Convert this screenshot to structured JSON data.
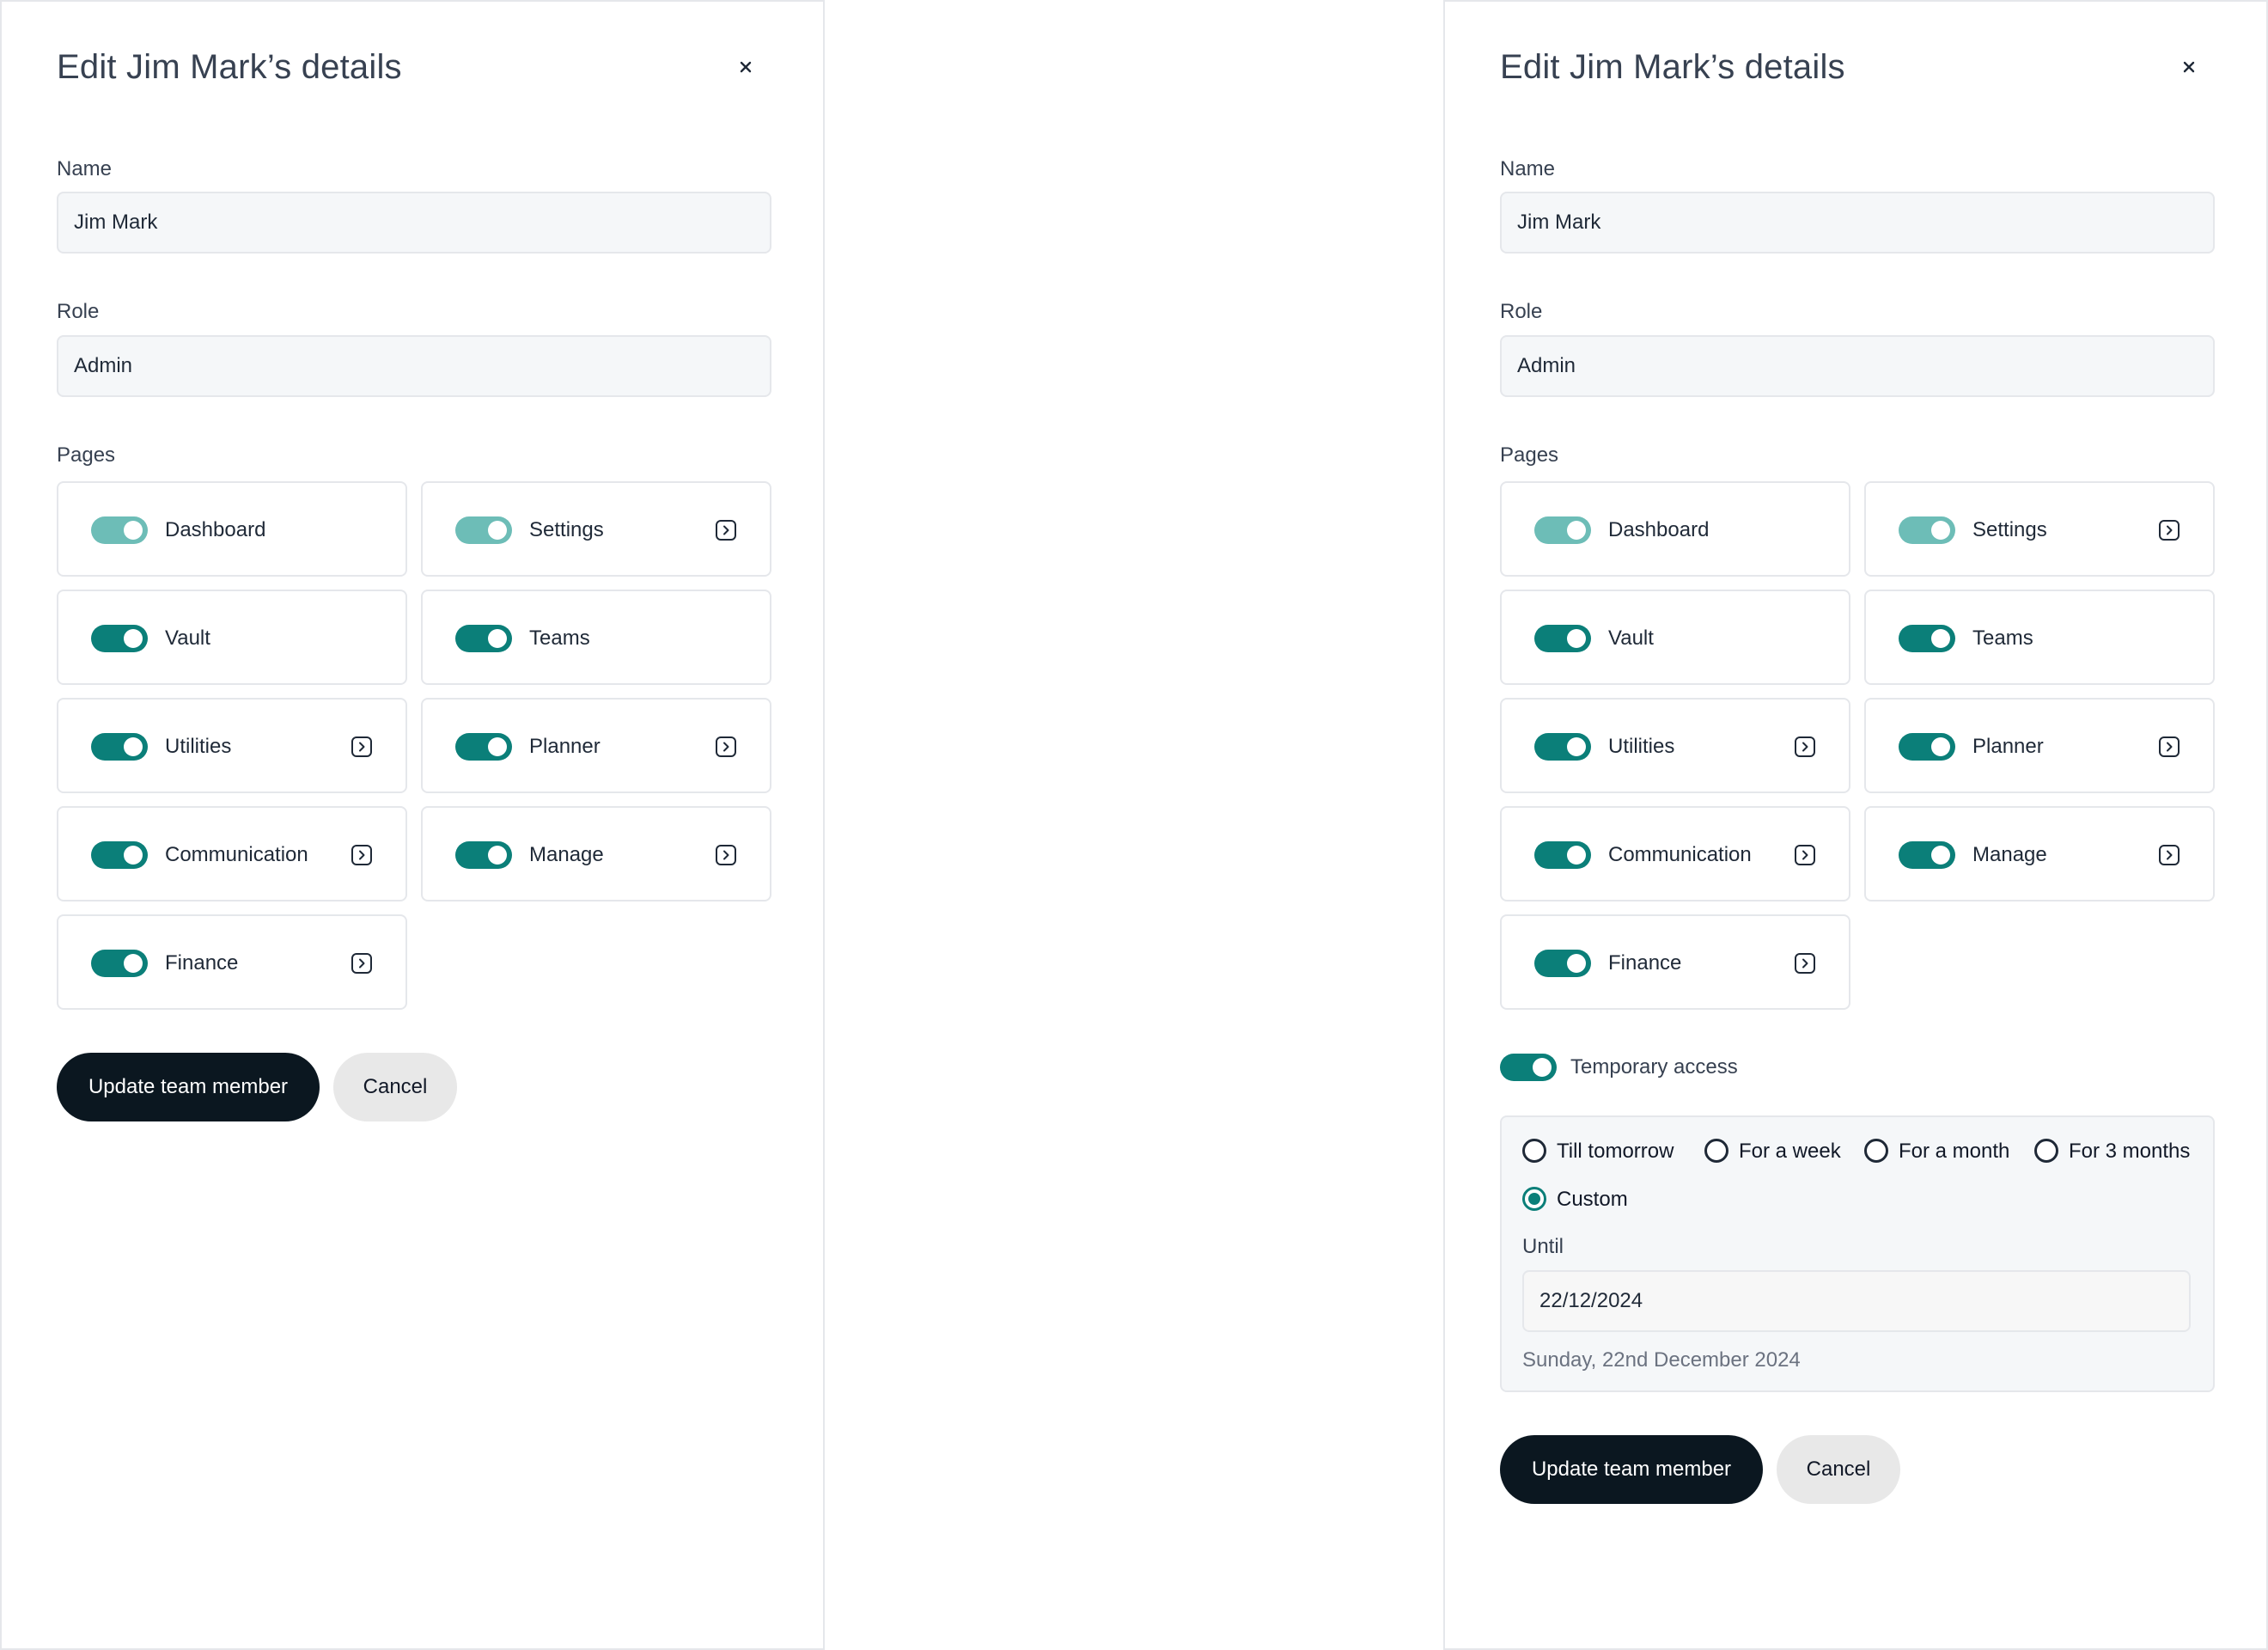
{
  "colors": {
    "accent": "#0b7f79",
    "accent_light": "#6dbdb7",
    "primary_button": "#0b1720",
    "secondary_button": "#e8e8e8",
    "input_bg": "#f5f7f9",
    "border": "#e5e7eb"
  },
  "icons": {
    "close": "close-icon",
    "page_arrow": "arrow-right-square-icon"
  },
  "left_panel": {
    "title": "Edit Jim Mark’s details",
    "name_label": "Name",
    "name_value": "Jim Mark",
    "role_label": "Role",
    "role_value": "Admin",
    "pages_label": "Pages",
    "pages": [
      {
        "label": "Dashboard",
        "enabled": true,
        "locked": true,
        "has_link": false
      },
      {
        "label": "Settings",
        "enabled": true,
        "locked": true,
        "has_link": true
      },
      {
        "label": "Vault",
        "enabled": true,
        "locked": false,
        "has_link": false
      },
      {
        "label": "Teams",
        "enabled": true,
        "locked": false,
        "has_link": false
      },
      {
        "label": "Utilities",
        "enabled": true,
        "locked": false,
        "has_link": true
      },
      {
        "label": "Planner",
        "enabled": true,
        "locked": false,
        "has_link": true
      },
      {
        "label": "Communication",
        "enabled": true,
        "locked": false,
        "has_link": true
      },
      {
        "label": "Manage",
        "enabled": true,
        "locked": false,
        "has_link": true
      },
      {
        "label": "Finance",
        "enabled": true,
        "locked": false,
        "has_link": true
      }
    ],
    "update_button": "Update team member",
    "cancel_button": "Cancel"
  },
  "right_panel": {
    "title": "Edit Jim Mark’s details",
    "name_label": "Name",
    "name_value": "Jim Mark",
    "role_label": "Role",
    "role_value": "Admin",
    "pages_label": "Pages",
    "pages": [
      {
        "label": "Dashboard",
        "enabled": true,
        "locked": true,
        "has_link": false
      },
      {
        "label": "Settings",
        "enabled": true,
        "locked": true,
        "has_link": true
      },
      {
        "label": "Vault",
        "enabled": true,
        "locked": false,
        "has_link": false
      },
      {
        "label": "Teams",
        "enabled": true,
        "locked": false,
        "has_link": false
      },
      {
        "label": "Utilities",
        "enabled": true,
        "locked": false,
        "has_link": true
      },
      {
        "label": "Planner",
        "enabled": true,
        "locked": false,
        "has_link": true
      },
      {
        "label": "Communication",
        "enabled": true,
        "locked": false,
        "has_link": true
      },
      {
        "label": "Manage",
        "enabled": true,
        "locked": false,
        "has_link": true
      },
      {
        "label": "Finance",
        "enabled": true,
        "locked": false,
        "has_link": true
      }
    ],
    "temporary_access": {
      "enabled": true,
      "label": "Temporary access",
      "options": [
        {
          "label": "Till tomorrow",
          "selected": false
        },
        {
          "label": "For a week",
          "selected": false
        },
        {
          "label": "For a month",
          "selected": false
        },
        {
          "label": "For 3 months",
          "selected": false
        },
        {
          "label": "Custom",
          "selected": true
        }
      ],
      "until_label": "Until",
      "until_value": "22/12/2024",
      "until_hint": "Sunday, 22nd December 2024"
    },
    "update_button": "Update team member",
    "cancel_button": "Cancel"
  }
}
